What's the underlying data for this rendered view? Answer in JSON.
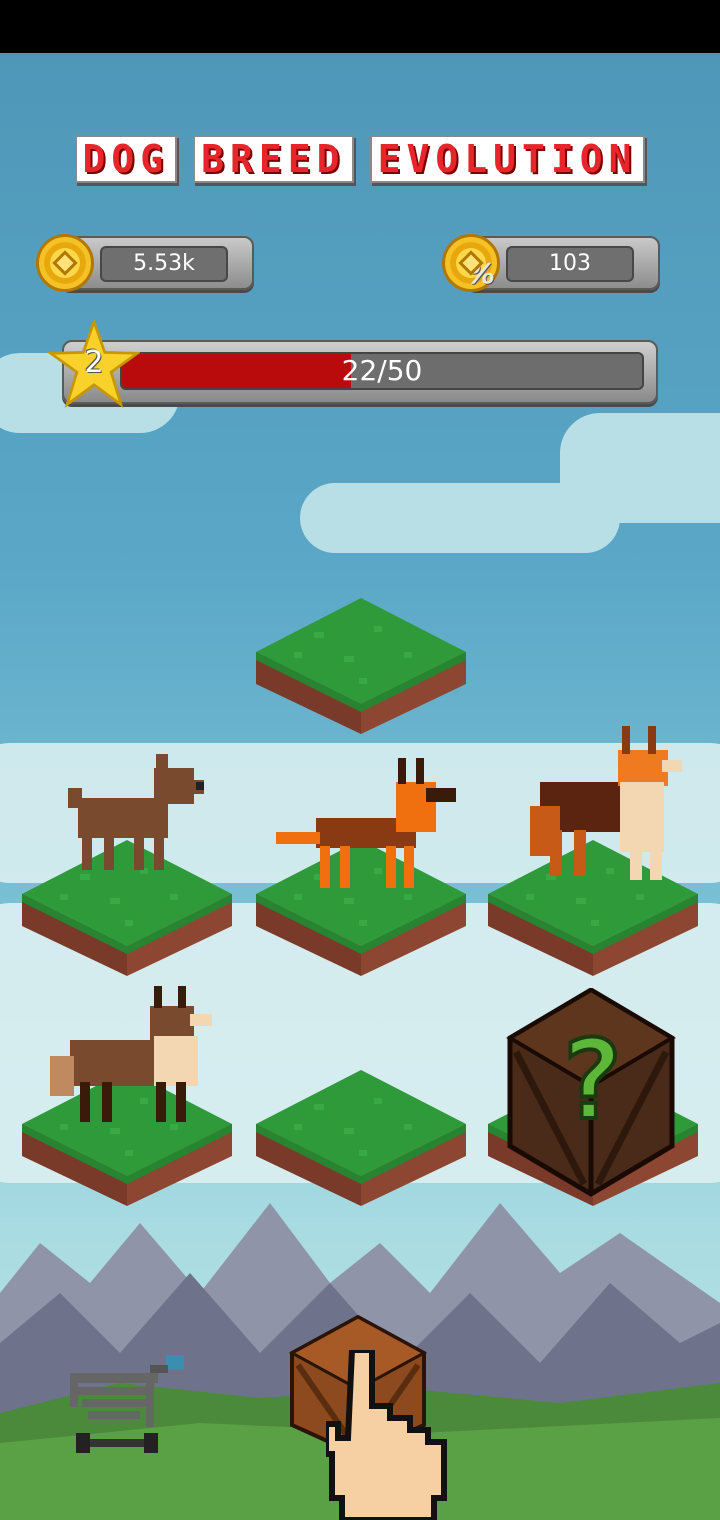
{
  "title": {
    "words": [
      "DOG",
      "BREED",
      "EVOLUTION"
    ]
  },
  "currency": {
    "coins": {
      "value": "5.53k",
      "icon": "gold-coin-icon"
    },
    "income_per_second": {
      "value": "103",
      "icon": "coin-per-second-icon"
    }
  },
  "level": {
    "number": "2",
    "progress_text": "22/50",
    "progress_fraction": 0.44
  },
  "board": {
    "slots": [
      {
        "row": 0,
        "col": 1,
        "content": "empty"
      },
      {
        "row": 1,
        "col": 0,
        "content": "dog",
        "breed_level": 1
      },
      {
        "row": 1,
        "col": 1,
        "content": "dog",
        "breed_level": 2
      },
      {
        "row": 1,
        "col": 2,
        "content": "dog",
        "breed_level": 3
      },
      {
        "row": 2,
        "col": 0,
        "content": "dog",
        "breed_level": 4
      },
      {
        "row": 2,
        "col": 1,
        "content": "empty"
      },
      {
        "row": 2,
        "col": 2,
        "content": "mystery-crate",
        "label": "?"
      }
    ]
  },
  "bottom_bar": {
    "shop_icon": "shopping-cart-icon",
    "spawn_icon": "wooden-crate-icon",
    "pointer_icon": "pointing-hand-icon"
  },
  "colors": {
    "title_red": "#e8252a",
    "progress_red": "#b90b0b",
    "grass": "#2f9a3a",
    "dirt": "#7a3a2a"
  }
}
